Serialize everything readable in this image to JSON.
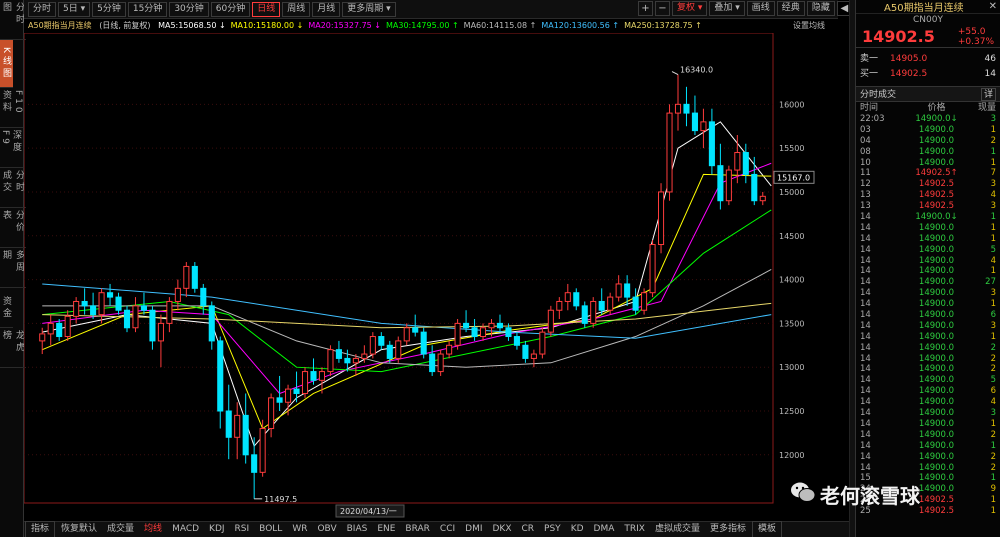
{
  "left_tabs": [
    {
      "label": "分时图",
      "active": false
    },
    {
      "label": "K线图",
      "active": true
    },
    {
      "label": "F10资料",
      "active": false
    },
    {
      "label": "深度F9",
      "active": false
    },
    {
      "label": "分时成交",
      "active": false
    },
    {
      "label": "分价表",
      "active": false
    },
    {
      "label": "多周期",
      "active": false
    },
    {
      "label": "资金",
      "active": false
    },
    {
      "label": "龙虎榜",
      "active": false
    }
  ],
  "toolbar": {
    "periods": [
      {
        "label": "分时",
        "active": false
      },
      {
        "label": "5日 ▾",
        "active": false
      },
      {
        "label": "5分钟",
        "active": false
      },
      {
        "label": "15分钟",
        "active": false
      },
      {
        "label": "30分钟",
        "active": false
      },
      {
        "label": "60分钟",
        "active": false
      },
      {
        "label": "日线",
        "active": true
      },
      {
        "label": "周线",
        "active": false
      },
      {
        "label": "月线",
        "active": false
      },
      {
        "label": "更多周期 ▾",
        "active": false
      }
    ],
    "right": {
      "plus": "+",
      "minus": "−",
      "fq": "复权 ▾",
      "overlay": "叠加 ▾",
      "drawline": "画线",
      "classic": "经典",
      "hide": "隐藏",
      "collapse": "◀"
    }
  },
  "ma_bar": {
    "title": "A50期指当月连续",
    "subtitle": "(日线, 前复权)",
    "items": [
      {
        "text": "MA5:15068.50 ↓",
        "color": "#ffffff"
      },
      {
        "text": "MA10:15180.00 ↓",
        "color": "#ffff00"
      },
      {
        "text": "MA20:15327.75 ↓",
        "color": "#ff00ff"
      },
      {
        "text": "MA30:14795.00 ↑",
        "color": "#00ff00"
      },
      {
        "text": "MA60:14115.08 ↑",
        "color": "#bbbbbb"
      },
      {
        "text": "MA120:13600.56 ↑",
        "color": "#40c0ff"
      },
      {
        "text": "MA250:13728.75 ↑",
        "color": "#e8d86a"
      }
    ],
    "settings": "设置均线"
  },
  "chart_data": {
    "type": "candlestick",
    "title": "A50期指当月连续",
    "subtitle": "(日线, 前复权)",
    "ylim": [
      11450,
      16700
    ],
    "yticks": [
      12000,
      12500,
      13000,
      13500,
      14000,
      14500,
      15000,
      15500,
      16000
    ],
    "current_price_label": "15167.0",
    "high_label": "16340.0",
    "low_label": "11497.5",
    "crosshair_date": "2020/04/13/一",
    "candles": [
      [
        13300,
        13450,
        13150,
        13380
      ],
      [
        13380,
        13600,
        13250,
        13500
      ],
      [
        13500,
        13550,
        13300,
        13350
      ],
      [
        13350,
        13650,
        13300,
        13580
      ],
      [
        13580,
        13800,
        13500,
        13750
      ],
      [
        13750,
        13900,
        13600,
        13700
      ],
      [
        13700,
        13850,
        13550,
        13600
      ],
      [
        13600,
        13900,
        13500,
        13850
      ],
      [
        13850,
        13950,
        13700,
        13800
      ],
      [
        13800,
        13850,
        13600,
        13650
      ],
      [
        13650,
        13700,
        13400,
        13450
      ],
      [
        13450,
        13800,
        13400,
        13700
      ],
      [
        13700,
        13850,
        13600,
        13650
      ],
      [
        13650,
        13700,
        13200,
        13300
      ],
      [
        13300,
        13600,
        13000,
        13500
      ],
      [
        13500,
        13800,
        13400,
        13750
      ],
      [
        13750,
        14000,
        13650,
        13900
      ],
      [
        13900,
        14200,
        13800,
        14150
      ],
      [
        14150,
        14200,
        13850,
        13900
      ],
      [
        13900,
        13950,
        13600,
        13700
      ],
      [
        13700,
        13750,
        13200,
        13300
      ],
      [
        13300,
        13350,
        12300,
        12500
      ],
      [
        12500,
        12800,
        11950,
        12200
      ],
      [
        12200,
        12600,
        11950,
        12450
      ],
      [
        12450,
        12700,
        11900,
        12000
      ],
      [
        12000,
        12200,
        11497.5,
        11800
      ],
      [
        11800,
        12400,
        11750,
        12300
      ],
      [
        12300,
        12700,
        12200,
        12650
      ],
      [
        12650,
        12900,
        12500,
        12600
      ],
      [
        12600,
        12800,
        12450,
        12750
      ],
      [
        12750,
        12950,
        12600,
        12700
      ],
      [
        12700,
        13000,
        12650,
        12950
      ],
      [
        12950,
        13100,
        12800,
        12850
      ],
      [
        12850,
        13000,
        12700,
        12950
      ],
      [
        12950,
        13250,
        12900,
        13200
      ],
      [
        13200,
        13300,
        13050,
        13100
      ],
      [
        13100,
        13200,
        12950,
        13050
      ],
      [
        13050,
        13150,
        12900,
        13100
      ],
      [
        13100,
        13250,
        13050,
        13150
      ],
      [
        13150,
        13400,
        13100,
        13350
      ],
      [
        13350,
        13400,
        13200,
        13250
      ],
      [
        13250,
        13300,
        13050,
        13100
      ],
      [
        13100,
        13350,
        13050,
        13300
      ],
      [
        13300,
        13500,
        13250,
        13450
      ],
      [
        13450,
        13600,
        13350,
        13400
      ],
      [
        13400,
        13450,
        13100,
        13150
      ],
      [
        13150,
        13250,
        12900,
        12950
      ],
      [
        12950,
        13200,
        12900,
        13150
      ],
      [
        13150,
        13300,
        13100,
        13250
      ],
      [
        13250,
        13550,
        13200,
        13500
      ],
      [
        13500,
        13650,
        13400,
        13450
      ],
      [
        13450,
        13550,
        13300,
        13350
      ],
      [
        13350,
        13500,
        13300,
        13450
      ],
      [
        13450,
        13550,
        13350,
        13500
      ],
      [
        13500,
        13600,
        13400,
        13450
      ],
      [
        13450,
        13500,
        13300,
        13350
      ],
      [
        13350,
        13400,
        13200,
        13250
      ],
      [
        13250,
        13300,
        13050,
        13100
      ],
      [
        13100,
        13200,
        13000,
        13150
      ],
      [
        13150,
        13450,
        13100,
        13400
      ],
      [
        13400,
        13700,
        13350,
        13650
      ],
      [
        13650,
        13800,
        13550,
        13750
      ],
      [
        13750,
        13950,
        13650,
        13850
      ],
      [
        13850,
        13900,
        13650,
        13700
      ],
      [
        13700,
        13750,
        13450,
        13500
      ],
      [
        13500,
        13800,
        13450,
        13750
      ],
      [
        13750,
        13900,
        13600,
        13650
      ],
      [
        13650,
        13850,
        13600,
        13800
      ],
      [
        13800,
        14050,
        13750,
        13950
      ],
      [
        13950,
        14050,
        13700,
        13800
      ],
      [
        13800,
        13900,
        13600,
        13650
      ],
      [
        13650,
        13900,
        13600,
        13850
      ],
      [
        13850,
        14450,
        13800,
        14400
      ],
      [
        14400,
        15100,
        14300,
        15000
      ],
      [
        15000,
        16000,
        14900,
        15900
      ],
      [
        15900,
        16340,
        15700,
        16000
      ],
      [
        16000,
        16200,
        15750,
        15900
      ],
      [
        15900,
        16100,
        15650,
        15700
      ],
      [
        15700,
        15950,
        15500,
        15800
      ],
      [
        15800,
        15950,
        15200,
        15300
      ],
      [
        15300,
        15550,
        14800,
        14900
      ],
      [
        14900,
        15300,
        14850,
        15250
      ],
      [
        15250,
        15650,
        15100,
        15450
      ],
      [
        15450,
        15550,
        15100,
        15200
      ],
      [
        15200,
        15400,
        14850,
        14900
      ],
      [
        14900,
        15000,
        14850,
        14950
      ]
    ],
    "ma": [
      {
        "name": "MA5",
        "color": "#ffffff",
        "values": [
          [
            0,
            13400
          ],
          [
            10,
            13600
          ],
          [
            20,
            13500
          ],
          [
            25,
            12100
          ],
          [
            30,
            12650
          ],
          [
            40,
            13200
          ],
          [
            50,
            13350
          ],
          [
            60,
            13450
          ],
          [
            70,
            13750
          ],
          [
            75,
            15500
          ],
          [
            80,
            15800
          ],
          [
            86,
            15068.5
          ]
        ]
      },
      {
        "name": "MA10",
        "color": "#ffff00",
        "values": [
          [
            0,
            13200
          ],
          [
            10,
            13600
          ],
          [
            20,
            13700
          ],
          [
            26,
            12300
          ],
          [
            32,
            12700
          ],
          [
            45,
            13250
          ],
          [
            55,
            13420
          ],
          [
            65,
            13550
          ],
          [
            72,
            13900
          ],
          [
            78,
            15200
          ],
          [
            86,
            15180
          ]
        ]
      },
      {
        "name": "MA20",
        "color": "#ff00ff",
        "values": [
          [
            0,
            13500
          ],
          [
            12,
            13650
          ],
          [
            20,
            13600
          ],
          [
            28,
            12700
          ],
          [
            35,
            12950
          ],
          [
            45,
            13150
          ],
          [
            55,
            13380
          ],
          [
            65,
            13550
          ],
          [
            73,
            13750
          ],
          [
            80,
            15100
          ],
          [
            86,
            15327.75
          ]
        ]
      },
      {
        "name": "MA30",
        "color": "#00ff00",
        "values": [
          [
            0,
            13600
          ],
          [
            15,
            13750
          ],
          [
            22,
            13600
          ],
          [
            30,
            13000
          ],
          [
            40,
            12950
          ],
          [
            50,
            13150
          ],
          [
            60,
            13350
          ],
          [
            70,
            13600
          ],
          [
            78,
            14300
          ],
          [
            86,
            14795
          ]
        ]
      },
      {
        "name": "MA60",
        "color": "#bbbbbb",
        "values": [
          [
            0,
            13700
          ],
          [
            20,
            13700
          ],
          [
            30,
            13300
          ],
          [
            40,
            13050
          ],
          [
            50,
            13000
          ],
          [
            60,
            13050
          ],
          [
            70,
            13350
          ],
          [
            78,
            13700
          ],
          [
            86,
            14115.08
          ]
        ]
      },
      {
        "name": "MA120",
        "color": "#40c0ff",
        "values": [
          [
            0,
            13950
          ],
          [
            20,
            13800
          ],
          [
            40,
            13500
          ],
          [
            55,
            13400
          ],
          [
            70,
            13330
          ],
          [
            86,
            13600.56
          ]
        ]
      },
      {
        "name": "MA250",
        "color": "#e8d86a",
        "values": [
          [
            0,
            13600
          ],
          [
            20,
            13550
          ],
          [
            40,
            13450
          ],
          [
            55,
            13470
          ],
          [
            70,
            13550
          ],
          [
            86,
            13728.75
          ]
        ]
      }
    ]
  },
  "bottom_tabs": [
    {
      "label": "指标",
      "active": false,
      "box": true
    },
    {
      "label": "恢复默认",
      "active": false,
      "box": false
    },
    {
      "label": "成交量",
      "active": false,
      "box": false
    },
    {
      "label": "均线",
      "active": true,
      "box": false
    },
    {
      "label": "MACD",
      "active": false,
      "box": false
    },
    {
      "label": "KDJ",
      "active": false,
      "box": false
    },
    {
      "label": "RSI",
      "active": false,
      "box": false
    },
    {
      "label": "BOLL",
      "active": false,
      "box": false
    },
    {
      "label": "WR",
      "active": false,
      "box": false
    },
    {
      "label": "OBV",
      "active": false,
      "box": false
    },
    {
      "label": "BIAS",
      "active": false,
      "box": false
    },
    {
      "label": "ENE",
      "active": false,
      "box": false
    },
    {
      "label": "BRAR",
      "active": false,
      "box": false
    },
    {
      "label": "CCI",
      "active": false,
      "box": false
    },
    {
      "label": "DMI",
      "active": false,
      "box": false
    },
    {
      "label": "DKX",
      "active": false,
      "box": false
    },
    {
      "label": "CR",
      "active": false,
      "box": false
    },
    {
      "label": "PSY",
      "active": false,
      "box": false
    },
    {
      "label": "KD",
      "active": false,
      "box": false
    },
    {
      "label": "DMA",
      "active": false,
      "box": false
    },
    {
      "label": "TRIX",
      "active": false,
      "box": false
    },
    {
      "label": "虚拟成交量",
      "active": false,
      "box": false
    },
    {
      "label": "更多指标",
      "active": false,
      "box": false
    },
    {
      "label": "模板",
      "active": false,
      "box": true
    }
  ],
  "right_panel": {
    "name": "A50期指当月连续",
    "close": "✕",
    "code": "CN00Y",
    "price": "14902.5",
    "change": "+55.0",
    "change_pct": "+0.37%",
    "ask_label": "卖一",
    "ask_price": "14905.0",
    "ask_vol": "46",
    "bid_label": "买一",
    "bid_price": "14902.5",
    "bid_vol": "14",
    "section_title": "分时成交",
    "detail_btn": "详",
    "col_time": "时间",
    "col_price": "价格",
    "col_vol": "现量",
    "trades": [
      [
        "22:03",
        "14900.0",
        "dn",
        "↓",
        "3"
      ],
      [
        "03",
        "14900.0",
        "dn",
        "",
        "1"
      ],
      [
        "04",
        "14900.0",
        "dn",
        "",
        "2"
      ],
      [
        "08",
        "14900.0",
        "dn",
        "",
        "1"
      ],
      [
        "10",
        "14900.0",
        "dn",
        "",
        "1"
      ],
      [
        "11",
        "14902.5",
        "up",
        "↑",
        "7"
      ],
      [
        "12",
        "14902.5",
        "up",
        "",
        "3"
      ],
      [
        "13",
        "14902.5",
        "up",
        "",
        "4"
      ],
      [
        "13",
        "14902.5",
        "up",
        "",
        "3"
      ],
      [
        "14",
        "14900.0",
        "dn",
        "↓",
        "1"
      ],
      [
        "14",
        "14900.0",
        "dn",
        "",
        "1"
      ],
      [
        "14",
        "14900.0",
        "dn",
        "",
        "1"
      ],
      [
        "14",
        "14900.0",
        "dn",
        "",
        "5"
      ],
      [
        "14",
        "14900.0",
        "dn",
        "",
        "4"
      ],
      [
        "14",
        "14900.0",
        "dn",
        "",
        "1"
      ],
      [
        "14",
        "14900.0",
        "dn",
        "",
        "27"
      ],
      [
        "14",
        "14900.0",
        "dn",
        "",
        "3"
      ],
      [
        "14",
        "14900.0",
        "dn",
        "",
        "1"
      ],
      [
        "14",
        "14900.0",
        "dn",
        "",
        "6"
      ],
      [
        "14",
        "14900.0",
        "dn",
        "",
        "3"
      ],
      [
        "14",
        "14900.0",
        "dn",
        "",
        "1"
      ],
      [
        "14",
        "14900.0",
        "dn",
        "",
        "2"
      ],
      [
        "14",
        "14900.0",
        "dn",
        "",
        "2"
      ],
      [
        "14",
        "14900.0",
        "dn",
        "",
        "2"
      ],
      [
        "14",
        "14900.0",
        "dn",
        "",
        "5"
      ],
      [
        "14",
        "14900.0",
        "dn",
        "",
        "6"
      ],
      [
        "14",
        "14900.0",
        "dn",
        "",
        "4"
      ],
      [
        "14",
        "14900.0",
        "dn",
        "",
        "3"
      ],
      [
        "14",
        "14900.0",
        "dn",
        "",
        "1"
      ],
      [
        "14",
        "14900.0",
        "dn",
        "",
        "2"
      ],
      [
        "14",
        "14900.0",
        "dn",
        "",
        "1"
      ],
      [
        "14",
        "14900.0",
        "dn",
        "",
        "2"
      ],
      [
        "14",
        "14900.0",
        "dn",
        "",
        "2"
      ],
      [
        "15",
        "14900.0",
        "dn",
        "",
        "1"
      ],
      [
        "24",
        "14900.0",
        "dn",
        "",
        "9"
      ],
      [
        "25",
        "14902.5",
        "up",
        "",
        "1"
      ],
      [
        "25",
        "14902.5",
        "up",
        "",
        "1"
      ]
    ]
  },
  "watermark": "老何滚雪球"
}
